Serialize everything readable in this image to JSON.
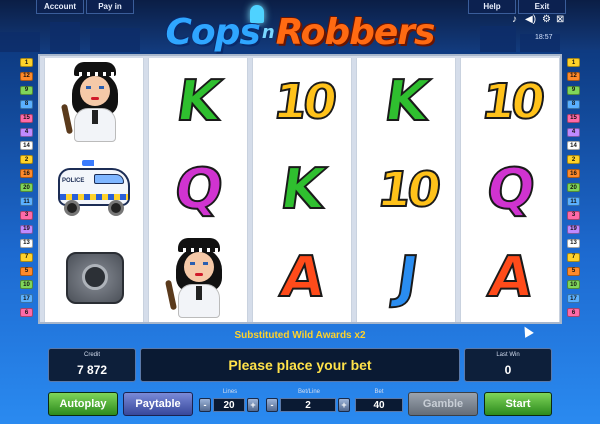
{
  "topbar": {
    "account_label": "Account",
    "payin_label": "Pay in",
    "help_label": "Help",
    "exit_label": "Exit",
    "clock": "18:57",
    "icons": [
      "music-note-icon",
      "speaker-icon",
      "settings-icon",
      "fullscreen-icon"
    ]
  },
  "logo": {
    "part1": "Cops",
    "part2": "n",
    "part3": "Robbers"
  },
  "reels": [
    [
      "cop",
      "police-car",
      "safe"
    ],
    [
      "K",
      "Q",
      "cop"
    ],
    [
      "10",
      "K",
      "A"
    ],
    [
      "K",
      "10",
      "J"
    ],
    [
      "10",
      "Q",
      "A"
    ]
  ],
  "line_markers": {
    "left": [
      "1",
      "12",
      "9",
      "8",
      "15",
      "4",
      "14",
      "2",
      "16",
      "20",
      "11",
      "3",
      "19",
      "13",
      "7",
      "5",
      "10",
      "17",
      "6"
    ],
    "right": [
      "1",
      "12",
      "9",
      "8",
      "15",
      "4",
      "14",
      "2",
      "16",
      "20",
      "11",
      "3",
      "19",
      "13",
      "7",
      "5",
      "10",
      "17",
      "6"
    ]
  },
  "message": "Substituted Wild Awards x2",
  "credit": {
    "label": "Credit",
    "value": "7 872"
  },
  "status": "Please place your bet",
  "last_win": {
    "label": "Last Win",
    "value": "0"
  },
  "controls": {
    "autoplay": "Autoplay",
    "paytable": "Paytable",
    "lines_label": "Lines",
    "lines_value": "20",
    "betline_label": "Bet/Line",
    "betline_value": "2",
    "bet_label": "Bet",
    "bet_value": "40",
    "gamble": "Gamble",
    "start": "Start",
    "minus": "-",
    "plus": "+"
  }
}
